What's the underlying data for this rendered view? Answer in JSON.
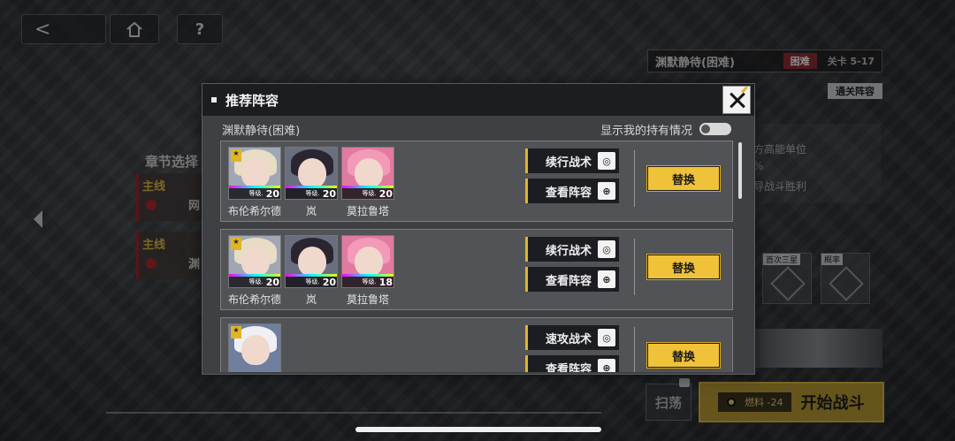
{
  "nav": {
    "back_icon": "<",
    "home_icon": "home-icon",
    "help_icon": "?"
  },
  "background": {
    "chapter_title": "章节选择",
    "chapters": [
      {
        "tag": "主线",
        "name": "网"
      },
      {
        "tag": "主线",
        "name": "渊"
      }
    ],
    "stage_panel": {
      "title": "渊默静待(困难)",
      "difficulty": "困难",
      "stage_no": "关卡 5-17",
      "clear_team_label": "通关阵容",
      "objectives": [
        "方高能单位",
        "%",
        "导战斗胜利"
      ],
      "rewards": [
        {
          "label": "首次三星"
        },
        {
          "label": "概率"
        }
      ],
      "sweep_label": "扫荡",
      "fuel_label": "燃料 -24",
      "start_label": "开始战斗"
    }
  },
  "modal": {
    "title": "推荐阵容",
    "stage_name": "渊默静待(困难)",
    "toggle_label": "显示我的持有情况",
    "teams": [
      {
        "members": [
          {
            "name": "布伦希尔德",
            "level": "20",
            "hair": "#e8dcc4",
            "bg": "#9fa7b4"
          },
          {
            "name": "岚",
            "level": "20",
            "hair": "#2a2630",
            "bg": "#6a6f80"
          },
          {
            "name": "莫拉鲁塔",
            "level": "20",
            "hair": "#f29ab8",
            "bg": "#e07aa0"
          }
        ],
        "tactic_label": "续行战术",
        "view_label": "查看阵容",
        "replace_label": "替换"
      },
      {
        "members": [
          {
            "name": "布伦希尔德",
            "level": "20",
            "hair": "#e8dcc4",
            "bg": "#9fa7b4"
          },
          {
            "name": "岚",
            "level": "20",
            "hair": "#2a2630",
            "bg": "#6a6f80"
          },
          {
            "name": "莫拉鲁塔",
            "level": "18",
            "hair": "#f29ab8",
            "bg": "#e07aa0"
          }
        ],
        "tactic_label": "续行战术",
        "view_label": "查看阵容",
        "replace_label": "替换"
      },
      {
        "members": [
          {
            "name": "",
            "level": "",
            "hair": "#f0f0f4",
            "bg": "#6e7fa0"
          }
        ],
        "tactic_label": "速攻战术",
        "view_label": "查看阵容",
        "replace_label": "替换"
      }
    ]
  }
}
